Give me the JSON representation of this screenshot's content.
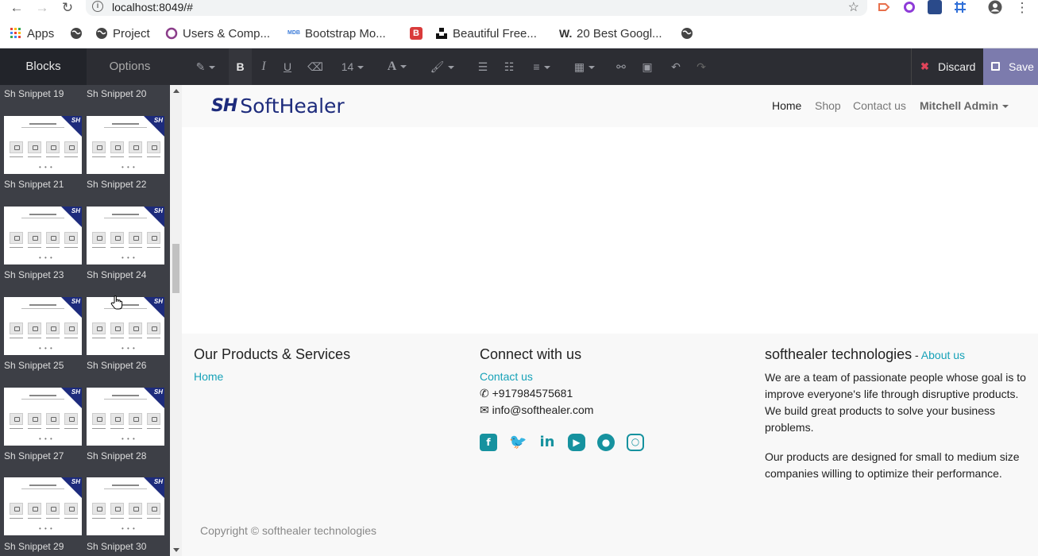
{
  "browser": {
    "url": "localhost:8049/#",
    "bookmarks": [
      {
        "label": "Apps",
        "icon": "apps-grid-icon"
      },
      {
        "label": "",
        "icon": "globe-icon"
      },
      {
        "label": "Project",
        "icon": "globe-icon"
      },
      {
        "label": "Users & Comp...",
        "icon": "odoo-circle-icon"
      },
      {
        "label": "Bootstrap Mo...",
        "icon": "mdb-icon"
      },
      {
        "label": "",
        "icon": "b-icon"
      },
      {
        "label": "Beautiful Free...",
        "icon": "unsplash-icon"
      },
      {
        "label": "20 Best Googl...",
        "icon": "w-icon"
      },
      {
        "label": "",
        "icon": "globe-icon"
      }
    ]
  },
  "sidebar": {
    "tabs": [
      "Blocks",
      "Options"
    ],
    "snippets": [
      "Sh Snippet 19",
      "Sh Snippet 20",
      "Sh Snippet 21",
      "Sh Snippet 22",
      "Sh Snippet 23",
      "Sh Snippet 24",
      "Sh Snippet 25",
      "Sh Snippet 26",
      "Sh Snippet 27",
      "Sh Snippet 28",
      "Sh Snippet 29",
      "Sh Snippet 30"
    ],
    "thumb_badge": "SH"
  },
  "toolbar": {
    "font_size": "14",
    "discard_label": "Discard",
    "save_label": "Save"
  },
  "site": {
    "logo_mark": "SH",
    "logo_text": "SoftHealer",
    "nav": {
      "home": "Home",
      "shop": "Shop",
      "contact": "Contact us",
      "user": "Mitchell Admin"
    },
    "footer": {
      "col1_title": "Our Products & Services",
      "col1_link": "Home",
      "col2_title": "Connect with us",
      "col2_link": "Contact us",
      "phone": "+917984575681",
      "email": "info@softhealer.com",
      "col3_title": "softhealer technologies",
      "col3_sep": " - ",
      "col3_link": "About us",
      "para1": "We are a team of passionate people whose goal is to improve everyone's life through disruptive products. We build great products to solve your business problems.",
      "para2": "Our products are designed for small to medium size companies willing to optimize their performance.",
      "copyright": "Copyright © softhealer technologies"
    }
  }
}
